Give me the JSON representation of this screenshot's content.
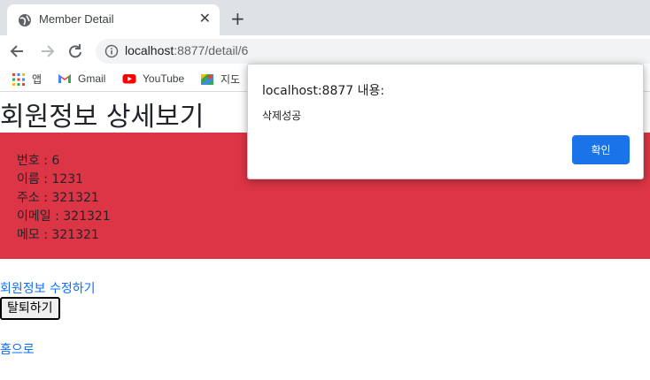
{
  "browser": {
    "tab": {
      "title": "Member Detail"
    },
    "omnibox": {
      "host": "localhost",
      "path": ":8877/detail/6"
    },
    "bookmarks": [
      {
        "label": "앱",
        "icon": "apps-grid-icon"
      },
      {
        "label": "Gmail",
        "icon": "gmail-icon"
      },
      {
        "label": "YouTube",
        "icon": "youtube-icon"
      },
      {
        "label": "지도",
        "icon": "maps-icon"
      }
    ]
  },
  "page": {
    "title": "회원정보 상세보기",
    "fields": [
      {
        "text": "번호 : 6"
      },
      {
        "text": "이름 : 1231"
      },
      {
        "text": "주소 : 321321"
      },
      {
        "text": "이메일 : 321321"
      },
      {
        "text": "메모 : 321321"
      }
    ],
    "edit_link": "회원정보 수정하기",
    "withdraw_button": "탈퇴하기",
    "home_link": "홈으로",
    "box_color": "#dc3545"
  },
  "dialog": {
    "title": "localhost:8877 내용:",
    "message": "삭제성공",
    "ok_label": "확인"
  }
}
